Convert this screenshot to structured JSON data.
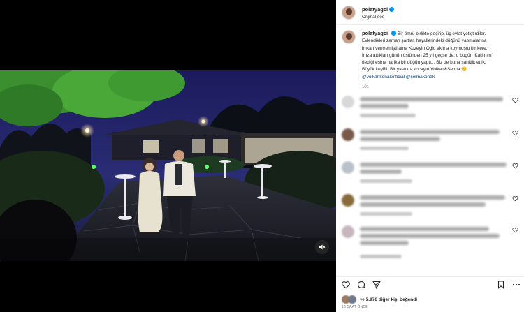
{
  "header": {
    "username": "polatyagci",
    "subtitle": "Orijinal ses"
  },
  "caption": {
    "username": "polatyagci",
    "lines": [
      "Bir ömrü birlikte geçirip, üç evlat yetiştirdiler.",
      "Evlendikleri zaman şartlar, hayallerindeki düğünü yapmalarına",
      "imkan vermemişti ama Kuzeyin Oğlu aklına koymuştu bir kere..",
      "İmza attıkları günün üstünden 25 yıl geçse de, o bugün 'Kadınım'",
      "dediği eşine harika bir düğün yaptı... Biz de buna şahitlik ettik.",
      "Büyük keyifti. Bir yastıkta kocayın Volkan&Selma 😊"
    ],
    "mentions": "@volkankonakofficial @selmakonak",
    "time": "10s"
  },
  "likes": {
    "prefix": "ve",
    "count_text": "5.976 diğer kişi beğendi"
  },
  "posted": "16 SAAT ÖNCE",
  "icons": {
    "like": "heart-icon",
    "comment": "comment-icon",
    "share": "paper-plane-icon",
    "save": "bookmark-icon",
    "more": "more-icon",
    "mute": "speaker-muted-icon"
  },
  "colors": {
    "verified": "#0095f6",
    "mention": "#00376b",
    "muted_text": "#737373"
  }
}
